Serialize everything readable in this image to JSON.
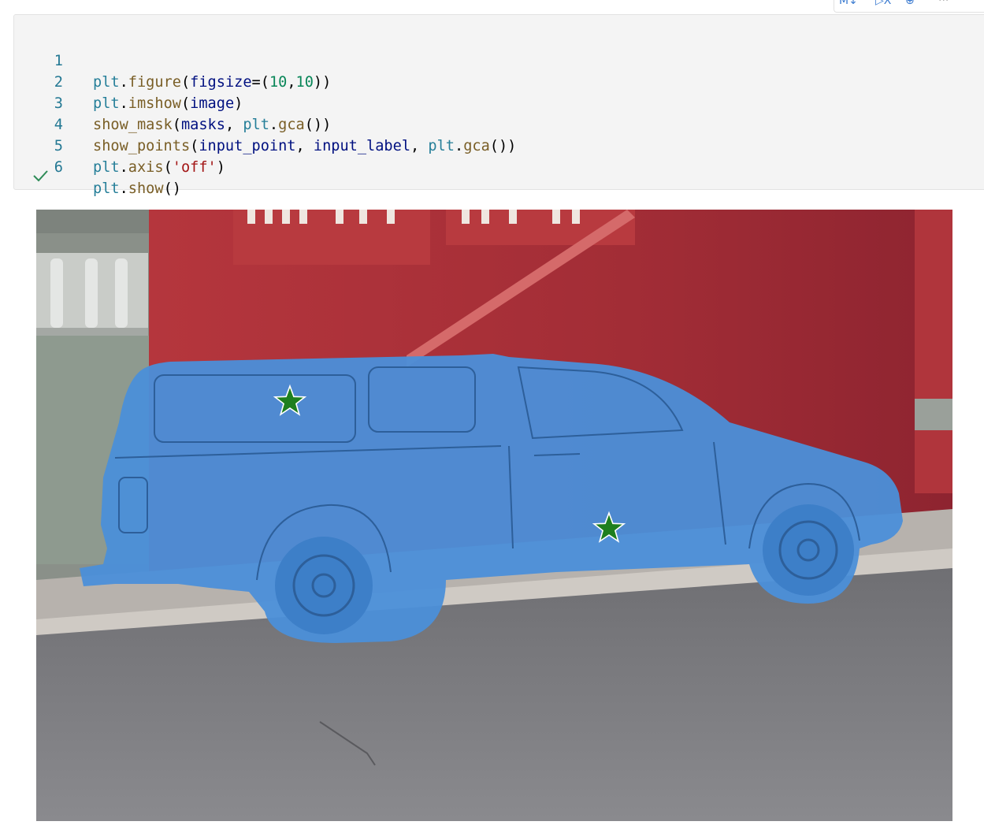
{
  "toolbar": {
    "markdown_label": "M↓",
    "execute_label": "▷X",
    "add_label": "⊕",
    "more_label": "···"
  },
  "code_cell": {
    "lines": [
      {
        "num": "1"
      },
      {
        "num": "2"
      },
      {
        "num": "3"
      },
      {
        "num": "4"
      },
      {
        "num": "5"
      },
      {
        "num": "6"
      }
    ],
    "tokens": {
      "l1": {
        "a": "plt",
        "b": ".",
        "c": "figure",
        "d": "(",
        "e": "figsize",
        "f": "=(",
        "g": "10",
        "h": ",",
        "i": "10",
        "j": "))"
      },
      "l2": {
        "a": "plt",
        "b": ".",
        "c": "imshow",
        "d": "(",
        "e": "image",
        "f": ")"
      },
      "l3": {
        "a": "show_mask",
        "b": "(",
        "c": "masks",
        "d": ", ",
        "e": "plt",
        "f": ".",
        "g": "gca",
        "h": "())"
      },
      "l4": {
        "a": "show_points",
        "b": "(",
        "c": "input_point",
        "d": ", ",
        "e": "input_label",
        "f": ", ",
        "g": "plt",
        "h": ".",
        "i": "gca",
        "j": "())"
      },
      "l5": {
        "a": "plt",
        "b": ".",
        "c": "axis",
        "d": "(",
        "e": "'off'",
        "f": ")"
      },
      "l6": {
        "a": "plt",
        "b": ".",
        "c": "show",
        "d": "()"
      }
    },
    "status": "success",
    "status_icon": "checkmark-icon"
  },
  "output": {
    "figure_kind": "segmentation-mask-output",
    "mask_color": "#4b8fd9",
    "point_marker_color": "#1e7f1e",
    "point_marker_icon": "star-icon",
    "points_count": 2
  },
  "colors": {
    "cell_background": "#f4f4f4",
    "line_number": "#237893",
    "check": "#2e8b57"
  }
}
